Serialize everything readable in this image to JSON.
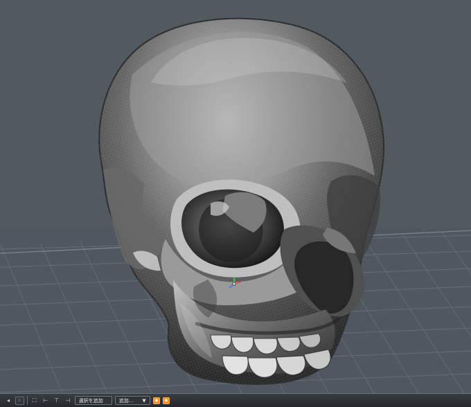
{
  "viewport": {
    "scene": "3D skull mesh viewport"
  },
  "toolbar": {
    "left_icons": [
      "◂",
      "⁙",
      "⛶",
      "⊢",
      "⊤",
      "⊣"
    ],
    "selection_add_label": "選択を追加",
    "add_label": "追加...",
    "add_arrow": "▼",
    "orange_buttons": [
      "◉",
      "◉"
    ]
  }
}
